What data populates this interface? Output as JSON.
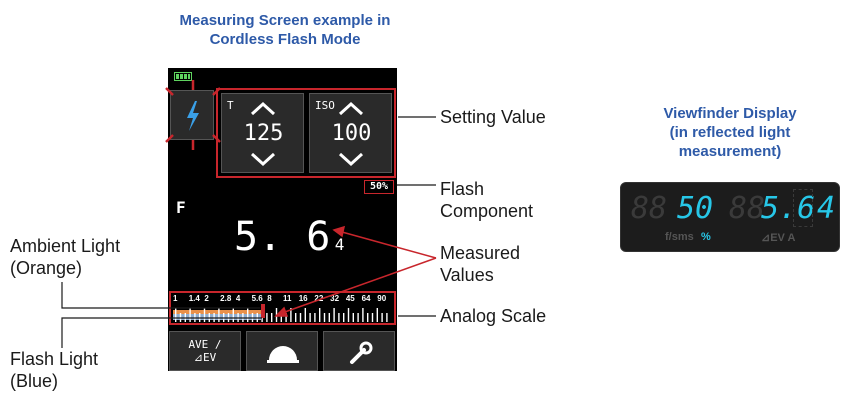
{
  "header": {
    "title_line1": "Measuring Screen example in",
    "title_line2": "Cordless Flash Mode"
  },
  "screen": {
    "shutter": {
      "label": "T",
      "value": "125"
    },
    "iso": {
      "label": "ISO",
      "value": "100"
    },
    "flash_component": "50%",
    "mode_letter": "F",
    "measured_main": "5. 6",
    "measured_sub": "4",
    "scale_labels": [
      "1",
      "1.4",
      "2",
      "2.8",
      "4",
      "5.6",
      "8",
      "11",
      "16",
      "22",
      "32",
      "45",
      "64",
      "90"
    ],
    "bottom_buttons": [
      {
        "label_line1": "AVE /",
        "label_line2": "⊿EV"
      },
      {
        "icon": "dome-icon"
      },
      {
        "icon": "wrench-icon"
      }
    ]
  },
  "callouts": {
    "setting_value": "Setting Value",
    "flash_component_line1": "Flash",
    "flash_component_line2": "Component",
    "measured_values_line1": "Measured",
    "measured_values_line2": "Values",
    "analog_scale": "Analog Scale",
    "ambient_line1": "Ambient Light",
    "ambient_line2": "(Orange)",
    "flash_line1": "Flash Light",
    "flash_line2": "(Blue)"
  },
  "viewfinder": {
    "title_line1": "Viewfinder Display",
    "title_line2": "(in reflected light",
    "title_line3": "measurement)",
    "segment_a": "50",
    "segment_b": "5.6",
    "segment_c": "4",
    "unit_left": "f/sms",
    "unit_percent": "%",
    "unit_right": "⊿EV A"
  },
  "colors": {
    "accent_blue": "#2e5aa8",
    "callout_red": "#c8262c",
    "lcd_cyan": "#27c7e8",
    "ambient_orange": "#e8904a",
    "flash_blue": "#7fb3e6"
  }
}
